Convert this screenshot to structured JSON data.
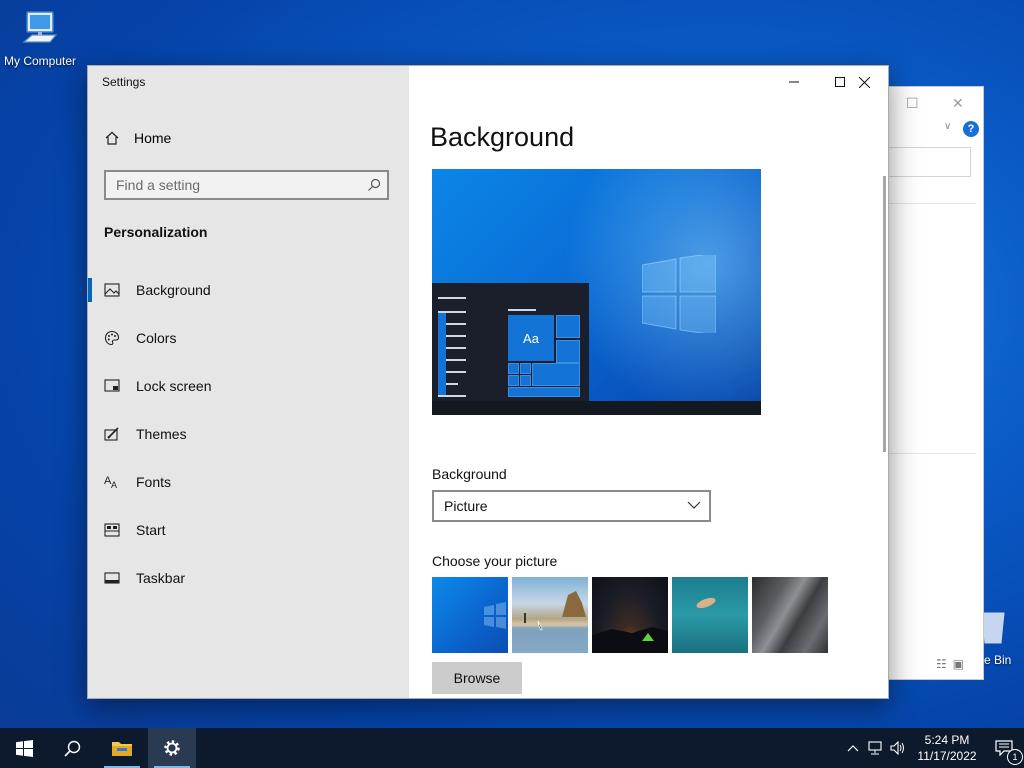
{
  "desktop": {
    "my_computer_label": "My Computer",
    "recycle_label": "e Bin"
  },
  "settings": {
    "window_title": "Settings",
    "home_label": "Home",
    "search_placeholder": "Find a setting",
    "section_title": "Personalization",
    "nav": [
      {
        "label": "Background",
        "icon": "image-icon",
        "active": true
      },
      {
        "label": "Colors",
        "icon": "palette-icon"
      },
      {
        "label": "Lock screen",
        "icon": "lock-screen-icon"
      },
      {
        "label": "Themes",
        "icon": "themes-icon"
      },
      {
        "label": "Fonts",
        "icon": "fonts-icon"
      },
      {
        "label": "Start",
        "icon": "start-icon"
      },
      {
        "label": "Taskbar",
        "icon": "taskbar-icon"
      }
    ],
    "page_title": "Background",
    "preview_tile_label": "Aa",
    "background_label": "Background",
    "background_value": "Picture",
    "choose_label": "Choose your picture",
    "thumbnails": [
      "Windows blue",
      "Beach rocks",
      "Night sky tent",
      "Underwater swimmer",
      "Rock cliff"
    ],
    "browse_label": "Browse"
  },
  "taskbar": {
    "time": "5:24 PM",
    "date": "11/17/2022",
    "notification_count": "1"
  },
  "colors": {
    "accent": "#0067c0",
    "sidebar_bg": "#e6e6e6",
    "taskbar_bg": "#0d1a2e"
  }
}
